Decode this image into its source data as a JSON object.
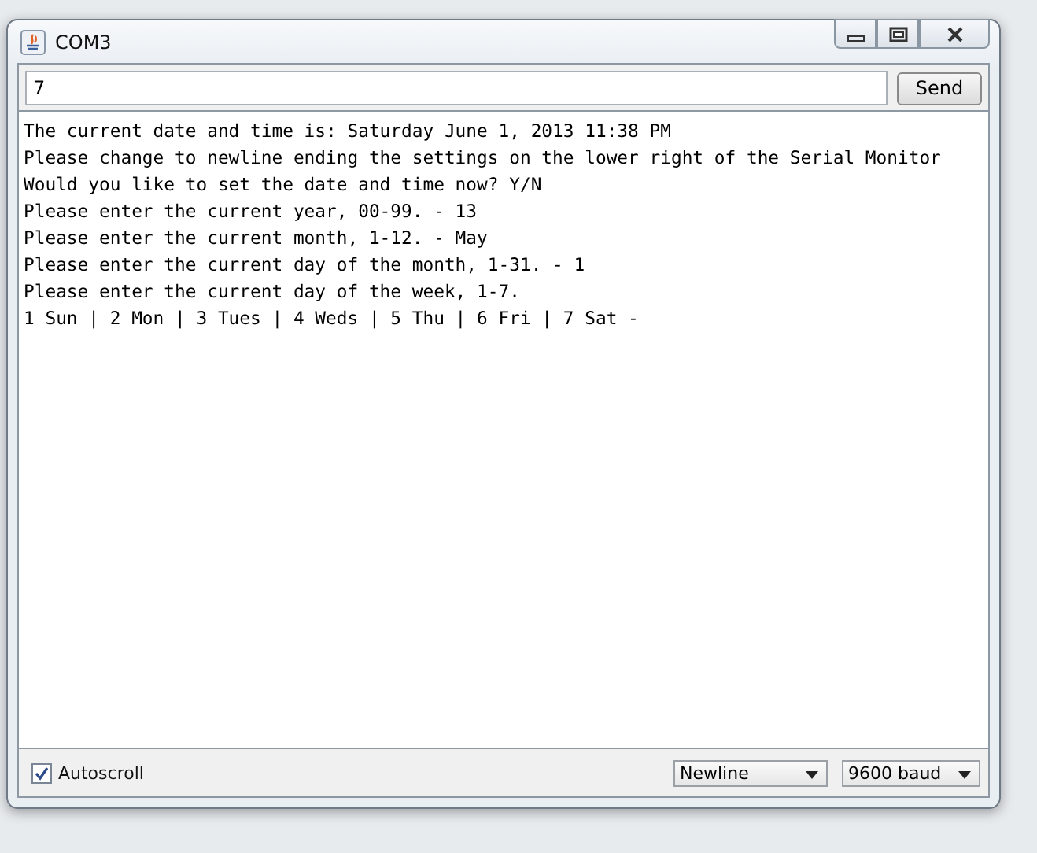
{
  "window": {
    "title": "COM3"
  },
  "input": {
    "value": "7"
  },
  "send_button": "Send",
  "output_lines": [
    "The current date and time is: Saturday June 1, 2013 11:38 PM",
    "Please change to newline ending the settings on the lower right of the Serial Monitor",
    "Would you like to set the date and time now? Y/N",
    "Please enter the current year, 00-99. - 13",
    "Please enter the current month, 1-12. - May",
    "Please enter the current day of the month, 1-31. - 1",
    "Please enter the current day of the week, 1-7.",
    "1 Sun | 2 Mon | 3 Tues | 4 Weds | 5 Thu | 6 Fri | 7 Sat -"
  ],
  "status_bar": {
    "autoscroll": {
      "label": "Autoscroll",
      "checked": true
    },
    "line_ending": "Newline",
    "baud_rate": "9600 baud"
  }
}
